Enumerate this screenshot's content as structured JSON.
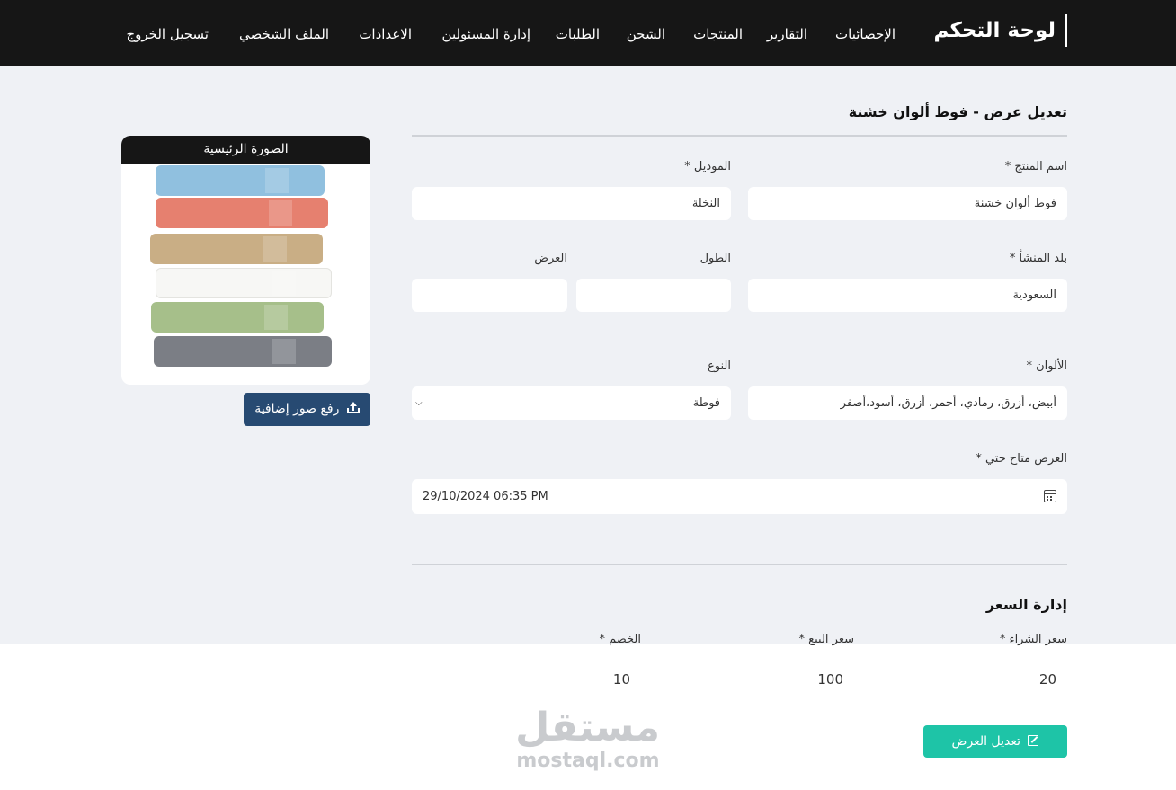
{
  "header": {
    "brand": "لوحة التحكم",
    "nav": [
      {
        "key": "stats",
        "label": "الإحصائيات"
      },
      {
        "key": "reports",
        "label": "التقارير"
      },
      {
        "key": "products",
        "label": "المنتجات"
      },
      {
        "key": "shipping",
        "label": "الشحن"
      },
      {
        "key": "orders",
        "label": "الطلبات"
      },
      {
        "key": "admins",
        "label": "إدارة المسئولين"
      },
      {
        "key": "settings",
        "label": "الاعدادات"
      },
      {
        "key": "profile",
        "label": "الملف الشخصي"
      },
      {
        "key": "logout",
        "label": "تسجيل الخروج"
      }
    ]
  },
  "form": {
    "title": "تعديل عرض - فوط ألوان خشنة",
    "product_name": {
      "label": "اسم المنتج *",
      "value": "فوط ألوان خشنة"
    },
    "model": {
      "label": "الموديل *",
      "value": "النخلة"
    },
    "origin": {
      "label": "بلد المنشأ *",
      "value": "السعودية"
    },
    "length": {
      "label": "الطول",
      "value": ""
    },
    "width": {
      "label": "العرض",
      "value": ""
    },
    "colors": {
      "label": "الألوان *",
      "value": "أبيض، أزرق، رمادي، أحمر، أزرق، أسود،أصفر"
    },
    "type": {
      "label": "النوع",
      "value": "فوطة"
    },
    "available_until": {
      "label": "العرض متاح حتي *",
      "value": "29/10/2024 06:35 PM"
    }
  },
  "pricing": {
    "title": "إدارة السعر",
    "purchase": {
      "label": "سعر الشراء *",
      "value": "20"
    },
    "sale": {
      "label": "سعر البيع *",
      "value": "100"
    },
    "discount": {
      "label": "الخصم *",
      "value": "10"
    }
  },
  "actions": {
    "submit": "تعديل العرض",
    "upload": "رفع صور إضافية"
  },
  "image_panel": {
    "title": "الصورة الرئيسية",
    "towel_colors": [
      "#90c0df",
      "#e6806f",
      "#c9ae85",
      "#f7f7f5",
      "#a6bf8a",
      "#7b7e85"
    ]
  },
  "watermark": {
    "ar": "مستقل",
    "en": "mostaql.com"
  },
  "colors": {
    "header_bg": "#161616",
    "submit": "#1ec4a7",
    "upload": "#274a72",
    "page_bg": "#eff1f5"
  }
}
